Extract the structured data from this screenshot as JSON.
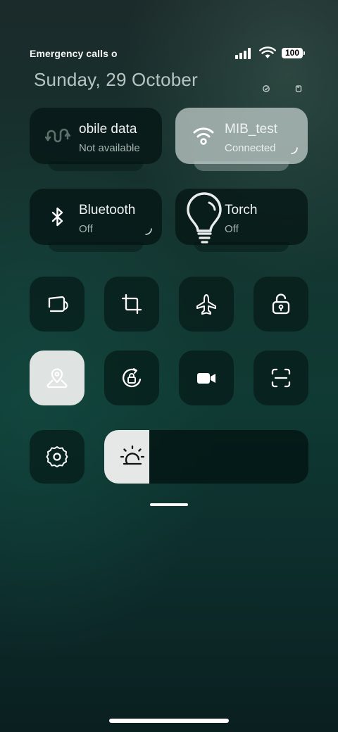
{
  "status_bar": {
    "left_text": "Emergency calls o",
    "battery_level": "100"
  },
  "date": "Sunday, 29 October",
  "tiles": {
    "mobile_data": {
      "title": "obile data",
      "subtitle": "Not available",
      "active": false
    },
    "wifi": {
      "title": "MIB_test",
      "subtitle": "Connected",
      "active": true
    },
    "bluetooth": {
      "title": "Bluetooth",
      "subtitle": "Off",
      "active": false
    },
    "torch": {
      "title": "Torch",
      "subtitle": "Off",
      "active": false
    }
  },
  "toggles": [
    {
      "icon": "auto-rotate-icon",
      "active": false
    },
    {
      "icon": "crop-screenshot-icon",
      "active": false
    },
    {
      "icon": "airplane-mode-icon",
      "active": false
    },
    {
      "icon": "lock-screen-icon",
      "active": false
    },
    {
      "icon": "location-icon",
      "active": true
    },
    {
      "icon": "rotation-lock-icon",
      "active": false
    },
    {
      "icon": "screen-record-icon",
      "active": false
    },
    {
      "icon": "scan-icon",
      "active": false
    }
  ],
  "settings_icon": "gear-icon",
  "brightness": {
    "level": 0.22,
    "icon": "brightness-sun-icon"
  },
  "colors": {
    "active_tile": "#dfe3e2",
    "inactive_tile": "#051a18",
    "accent_white": "#ffffff"
  }
}
